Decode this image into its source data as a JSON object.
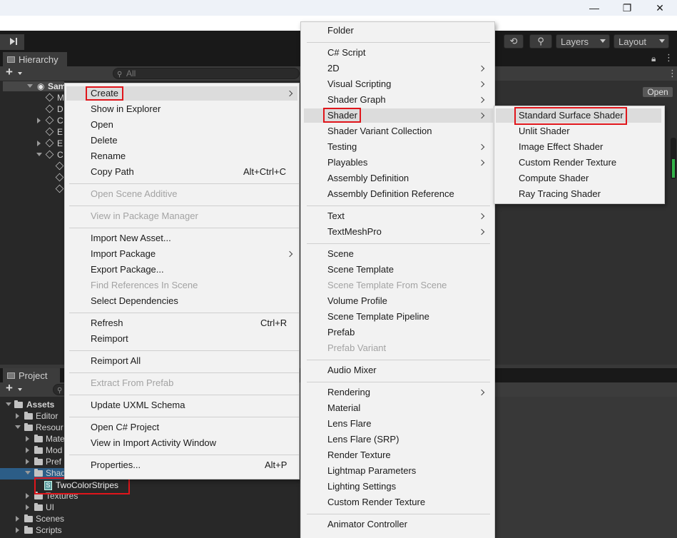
{
  "window": {
    "min_icon": "minimize-icon",
    "restore_icon": "restore-icon",
    "close_icon": "close-icon"
  },
  "toolbar": {
    "layers_label": "Layers",
    "layout_label": "Layout"
  },
  "hierarchy": {
    "tab_label": "Hierarchy",
    "search_placeholder": "All",
    "scene_name": "Sam",
    "items": [
      "M",
      "D",
      "C",
      "E",
      "E",
      "C"
    ]
  },
  "inspector": {
    "open_label": "Open"
  },
  "project": {
    "tab_label": "Project",
    "tree": {
      "assets": "Assets",
      "editor": "Editor",
      "resources": "Resour",
      "materials": "Mate",
      "models": "Mod",
      "prefabs": "Pref",
      "shaders": "Shad",
      "selected_asset": "TwoColorStripes",
      "textures": "Textures",
      "ui": "UI",
      "scenes": "Scenes",
      "scripts": "Scripts"
    }
  },
  "context_menu": {
    "create": "Create",
    "show_in_explorer": "Show in Explorer",
    "open": "Open",
    "delete": "Delete",
    "rename": "Rename",
    "copy_path": "Copy Path",
    "copy_path_shortcut": "Alt+Ctrl+C",
    "open_scene_additive": "Open Scene Additive",
    "view_in_package_manager": "View in Package Manager",
    "import_new_asset": "Import New Asset...",
    "import_package": "Import Package",
    "export_package": "Export Package...",
    "find_references": "Find References In Scene",
    "select_dependencies": "Select Dependencies",
    "refresh": "Refresh",
    "refresh_shortcut": "Ctrl+R",
    "reimport": "Reimport",
    "reimport_all": "Reimport All",
    "extract_from_prefab": "Extract From Prefab",
    "update_uxml": "Update UXML Schema",
    "open_csharp_project": "Open C# Project",
    "view_import_activity": "View in Import Activity Window",
    "properties": "Properties...",
    "properties_shortcut": "Alt+P"
  },
  "create_menu": {
    "folder": "Folder",
    "csharp_script": "C# Script",
    "two_d": "2D",
    "visual_scripting": "Visual Scripting",
    "shader_graph": "Shader Graph",
    "shader": "Shader",
    "shader_variant_collection": "Shader Variant Collection",
    "testing": "Testing",
    "playables": "Playables",
    "assembly_definition": "Assembly Definition",
    "assembly_definition_reference": "Assembly Definition Reference",
    "text": "Text",
    "textmeshpro": "TextMeshPro",
    "scene": "Scene",
    "scene_template": "Scene Template",
    "scene_template_from_scene": "Scene Template From Scene",
    "volume_profile": "Volume Profile",
    "scene_template_pipeline": "Scene Template Pipeline",
    "prefab": "Prefab",
    "prefab_variant": "Prefab Variant",
    "audio_mixer": "Audio Mixer",
    "rendering": "Rendering",
    "material": "Material",
    "lens_flare": "Lens Flare",
    "lens_flare_srp": "Lens Flare (SRP)",
    "render_texture": "Render Texture",
    "lightmap_parameters": "Lightmap Parameters",
    "lighting_settings": "Lighting Settings",
    "custom_render_texture": "Custom Render Texture",
    "animator_controller": "Animator Controller"
  },
  "shader_menu": {
    "standard_surface": "Standard Surface Shader",
    "unlit": "Unlit Shader",
    "image_effect": "Image Effect Shader",
    "custom_render_texture": "Custom Render Texture",
    "compute": "Compute Shader",
    "ray_tracing": "Ray Tracing Shader"
  },
  "colors": {
    "highlight": "#e0151b",
    "selection": "#2c5d87",
    "menu_bg": "#f2f2f2"
  }
}
